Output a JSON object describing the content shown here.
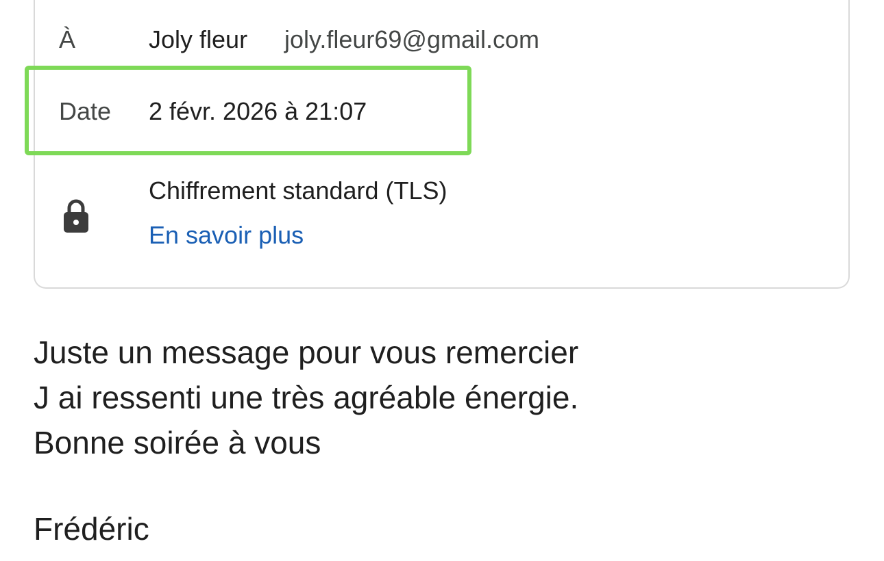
{
  "details": {
    "to": {
      "label": "À",
      "name": "Joly fleur",
      "email": "joly.fleur69@gmail.com"
    },
    "date": {
      "label": "Date",
      "value": "2 févr. 2026 à 21:07"
    },
    "security": {
      "icon": "lock-icon",
      "title": "Chiffrement standard (TLS)",
      "link_label": "En savoir plus"
    }
  },
  "highlight_color": "#7ed957",
  "link_color": "#1a5fb4",
  "message": {
    "lines": [
      "Juste un message pour vous remercier",
      "J ai ressenti une très agréable énergie.",
      "Bonne soirée à vous"
    ],
    "signature": "Frédéric"
  }
}
